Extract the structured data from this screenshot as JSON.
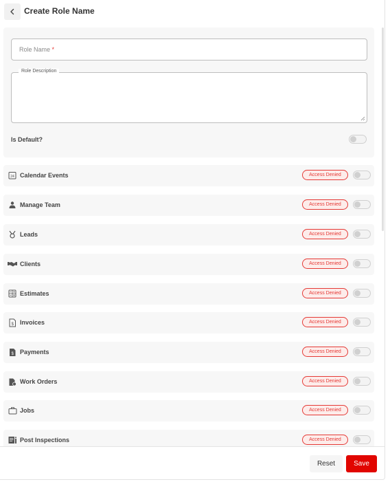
{
  "header": {
    "title": "Create Role Name"
  },
  "form": {
    "role_name_placeholder": "Role Name",
    "required_mark": "*",
    "role_description_label": "Role Description",
    "is_default_label": "Is Default?"
  },
  "permissions": [
    {
      "label": "Calendar Events",
      "icon": "calendar-icon",
      "status": "Access Denied"
    },
    {
      "label": "Manage Team",
      "icon": "team-icon",
      "status": "Access Denied"
    },
    {
      "label": "Leads",
      "icon": "leads-icon",
      "status": "Access Denied"
    },
    {
      "label": "Clients",
      "icon": "handshake-icon",
      "status": "Access Denied"
    },
    {
      "label": "Estimates",
      "icon": "calculator-icon",
      "status": "Access Denied"
    },
    {
      "label": "Invoices",
      "icon": "invoice-icon",
      "status": "Access Denied"
    },
    {
      "label": "Payments",
      "icon": "payment-icon",
      "status": "Access Denied"
    },
    {
      "label": "Work Orders",
      "icon": "work-order-icon",
      "status": "Access Denied"
    },
    {
      "label": "Jobs",
      "icon": "briefcase-icon",
      "status": "Access Denied"
    },
    {
      "label": "Post Inspections",
      "icon": "inspection-icon",
      "status": "Access Denied"
    }
  ],
  "footer": {
    "reset_label": "Reset",
    "save_label": "Save"
  },
  "colors": {
    "accent": "#e10600",
    "denied": "#e53935"
  }
}
